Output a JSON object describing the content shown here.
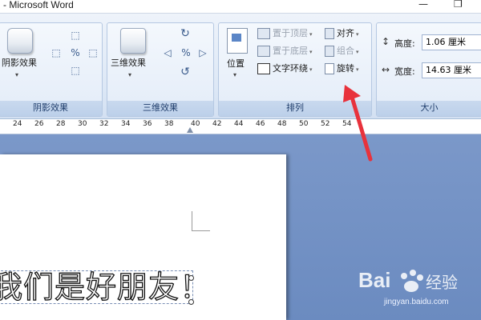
{
  "window": {
    "title": "- Microsoft Word"
  },
  "ribbon": {
    "shadow_group": {
      "button_label": "阴影效果",
      "group_label": "阴影效果"
    },
    "threed_group": {
      "button_label": "三维效果",
      "group_label": "三维效果"
    },
    "arrange_group": {
      "position_label": "位置",
      "bring_front": "置于顶层",
      "send_back": "置于底层",
      "text_wrap": "文字环绕",
      "align": "对齐",
      "group": "组合",
      "rotate": "旋转",
      "group_label": "排列"
    },
    "size_group": {
      "height_label": "高度:",
      "height_value": "1.06 厘米",
      "width_label": "宽度:",
      "width_value": "14.63 厘米",
      "group_label": "大小"
    }
  },
  "ruler": {
    "ticks": [
      "24",
      "26",
      "28",
      "30",
      "32",
      "34",
      "36",
      "38",
      "40",
      "42",
      "44",
      "46",
      "48",
      "50",
      "52",
      "54"
    ]
  },
  "document": {
    "text": "我们是好朋友！"
  },
  "watermark": {
    "logo": "Bai",
    "logo2": "经验",
    "url": "jingyan.baidu.com"
  },
  "colors": {
    "accent": "#e8323c",
    "ribbon": "#dde8f6",
    "doc_bg": "#6f8fc6"
  }
}
